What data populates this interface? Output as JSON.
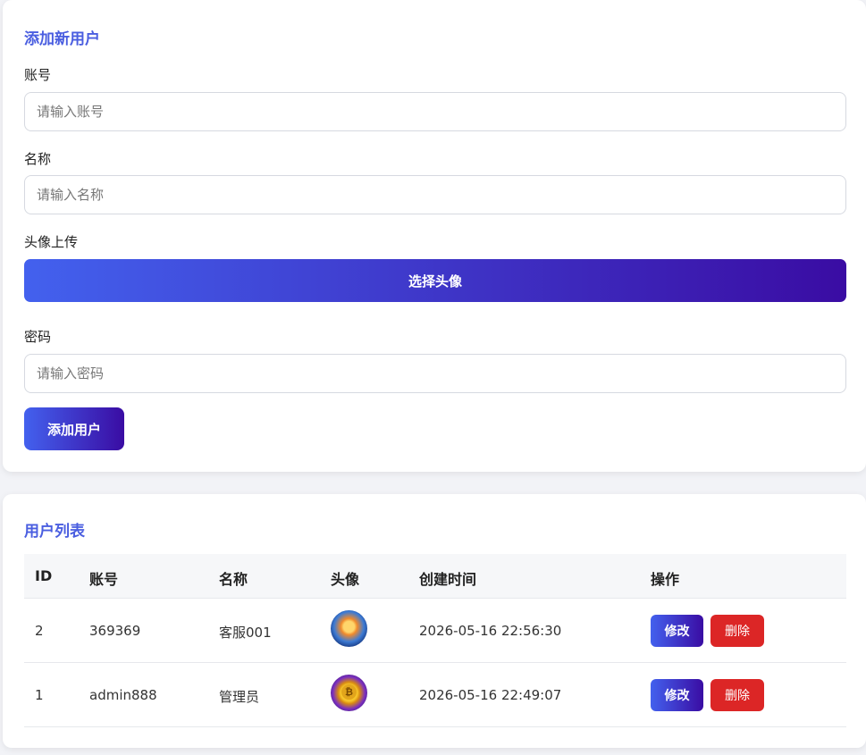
{
  "add_form": {
    "title": "添加新用户",
    "account_label": "账号",
    "account_placeholder": "请输入账号",
    "name_label": "名称",
    "name_placeholder": "请输入名称",
    "avatar_label": "头像上传",
    "avatar_button": "选择头像",
    "password_label": "密码",
    "password_placeholder": "请输入密码",
    "submit_button": "添加用户"
  },
  "user_list": {
    "title": "用户列表",
    "columns": [
      "ID",
      "账号",
      "名称",
      "头像",
      "创建时间",
      "操作"
    ],
    "rows": [
      {
        "id": "2",
        "account": "369369",
        "name": "客服001",
        "avatar_icon": "avatar-image-1",
        "created": "2026-05-16 22:56:30",
        "edit": "修改",
        "delete": "删除"
      },
      {
        "id": "1",
        "account": "admin888",
        "name": "管理员",
        "avatar_icon": "avatar-image-2",
        "created": "2026-05-16 22:49:07",
        "edit": "修改",
        "delete": "删除"
      }
    ]
  },
  "colors": {
    "accent": "#4a5ee0",
    "gradient_start": "#4361ee",
    "gradient_end": "#3a0ca3",
    "danger": "#dc2626"
  }
}
